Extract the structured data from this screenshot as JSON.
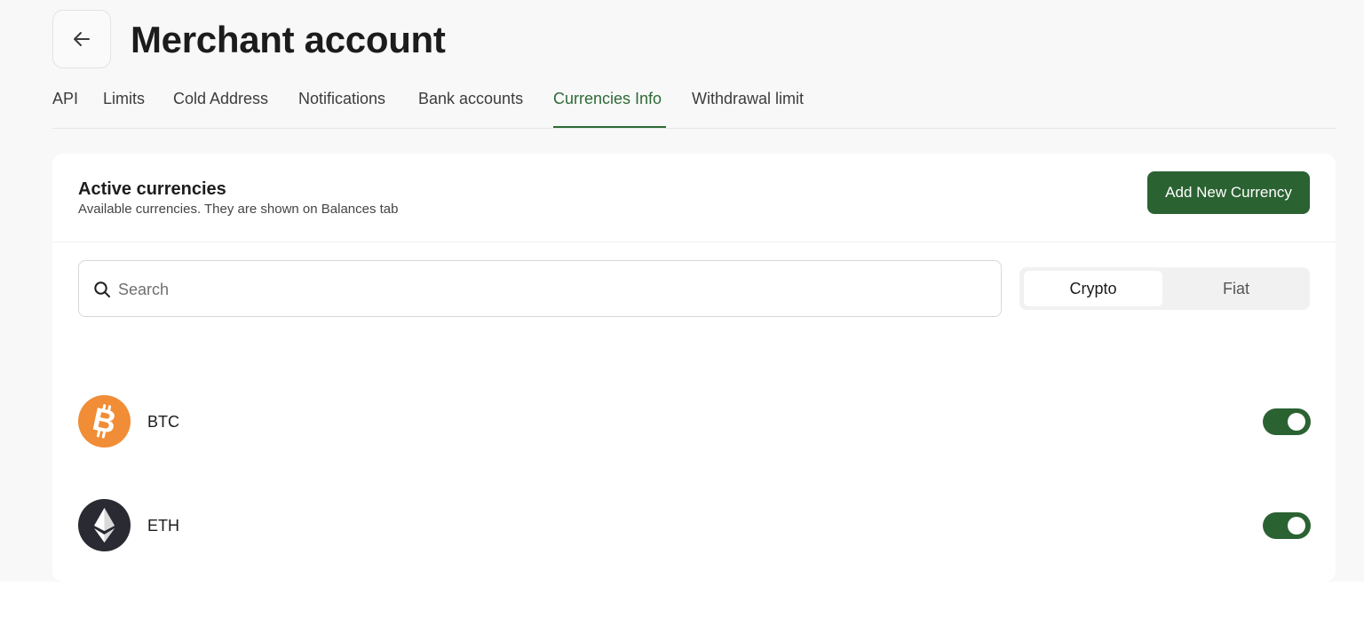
{
  "header": {
    "back_icon": "arrow-left-icon",
    "title": "Merchant account"
  },
  "tabs": [
    {
      "label": "API",
      "active": false
    },
    {
      "label": "Limits",
      "active": false
    },
    {
      "label": "Cold Address",
      "active": false
    },
    {
      "label": "Notifications",
      "active": false
    },
    {
      "label": "Bank accounts",
      "active": false
    },
    {
      "label": "Currencies Info",
      "active": true
    },
    {
      "label": "Withdrawal limit",
      "active": false
    }
  ],
  "card": {
    "title": "Active currencies",
    "subtitle": "Available currencies. They are shown on Balances tab",
    "add_button_label": "Add New Currency"
  },
  "search": {
    "icon": "search-icon",
    "placeholder": "Search",
    "value": ""
  },
  "filter": {
    "options": [
      "Crypto",
      "Fiat"
    ],
    "selected": "Crypto"
  },
  "currencies": [
    {
      "code": "BTC",
      "icon": "bitcoin-icon",
      "icon_color": "#f18d36",
      "enabled": true
    },
    {
      "code": "ETH",
      "icon": "ethereum-icon",
      "icon_color": "#2a2a33",
      "enabled": true
    }
  ],
  "colors": {
    "accent": "#2b6232",
    "active_tab": "#2e6a36",
    "page_background": "#f8f8f8"
  }
}
